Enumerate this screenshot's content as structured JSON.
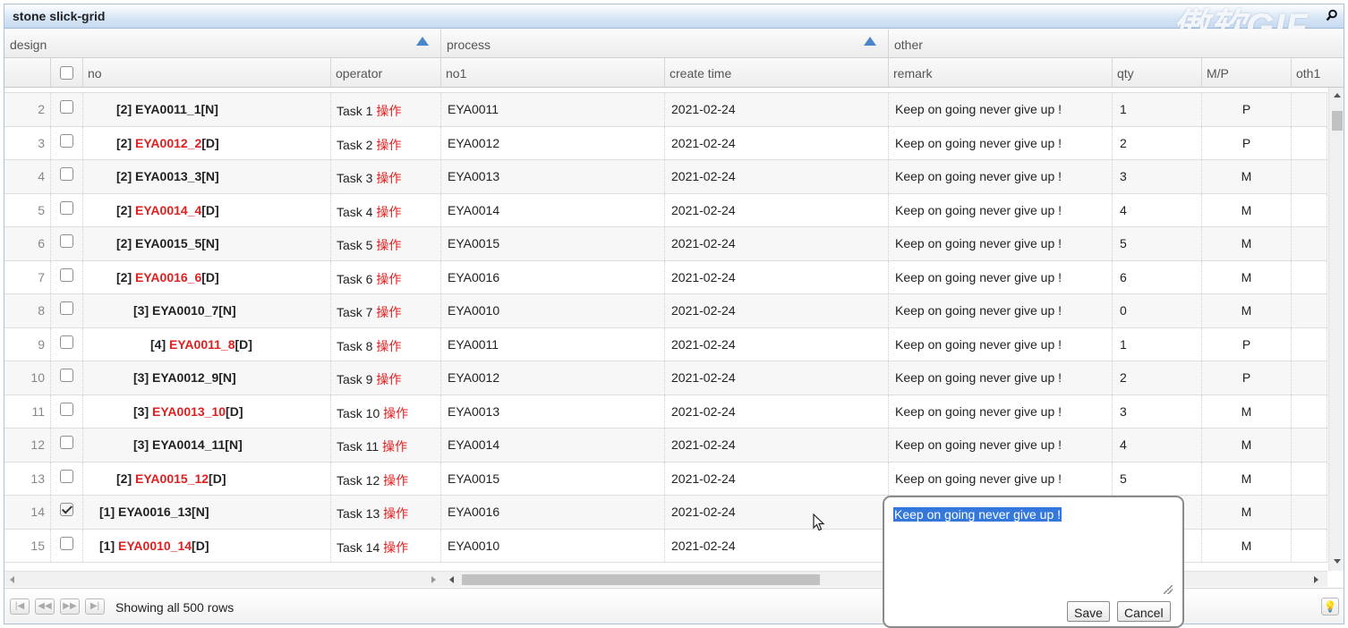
{
  "window": {
    "title": "stone slick-grid",
    "watermark": "傲软GIF"
  },
  "group_headers": [
    "design",
    "process",
    "other"
  ],
  "columns": [
    "no",
    "operator",
    "no1",
    "create time",
    "remark",
    "qty",
    "M/P",
    "oth1"
  ],
  "rows": [
    {
      "num": "2",
      "checked": false,
      "level": 2,
      "code": "EYA0011_1",
      "flag": "N",
      "task": "Task 1",
      "op": "操作",
      "no1": "EYA0011",
      "created": "2021-02-24",
      "remark": "Keep on going never give up !",
      "qty": "1",
      "mp": "P"
    },
    {
      "num": "3",
      "checked": false,
      "level": 2,
      "code": "EYA0012_2",
      "flag": "D",
      "task": "Task 2",
      "op": "操作",
      "no1": "EYA0012",
      "created": "2021-02-24",
      "remark": "Keep on going never give up !",
      "qty": "2",
      "mp": "P"
    },
    {
      "num": "4",
      "checked": false,
      "level": 2,
      "code": "EYA0013_3",
      "flag": "N",
      "task": "Task 3",
      "op": "操作",
      "no1": "EYA0013",
      "created": "2021-02-24",
      "remark": "Keep on going never give up !",
      "qty": "3",
      "mp": "M"
    },
    {
      "num": "5",
      "checked": false,
      "level": 2,
      "code": "EYA0014_4",
      "flag": "D",
      "task": "Task 4",
      "op": "操作",
      "no1": "EYA0014",
      "created": "2021-02-24",
      "remark": "Keep on going never give up !",
      "qty": "4",
      "mp": "M"
    },
    {
      "num": "6",
      "checked": false,
      "level": 2,
      "code": "EYA0015_5",
      "flag": "N",
      "task": "Task 5",
      "op": "操作",
      "no1": "EYA0015",
      "created": "2021-02-24",
      "remark": "Keep on going never give up !",
      "qty": "5",
      "mp": "M"
    },
    {
      "num": "7",
      "checked": false,
      "level": 2,
      "code": "EYA0016_6",
      "flag": "D",
      "task": "Task 6",
      "op": "操作",
      "no1": "EYA0016",
      "created": "2021-02-24",
      "remark": "Keep on going never give up !",
      "qty": "6",
      "mp": "M"
    },
    {
      "num": "8",
      "checked": false,
      "level": 3,
      "code": "EYA0010_7",
      "flag": "N",
      "task": "Task 7",
      "op": "操作",
      "no1": "EYA0010",
      "created": "2021-02-24",
      "remark": "Keep on going never give up !",
      "qty": "0",
      "mp": "M"
    },
    {
      "num": "9",
      "checked": false,
      "level": 4,
      "code": "EYA0011_8",
      "flag": "D",
      "task": "Task 8",
      "op": "操作",
      "no1": "EYA0011",
      "created": "2021-02-24",
      "remark": "Keep on going never give up !",
      "qty": "1",
      "mp": "P"
    },
    {
      "num": "10",
      "checked": false,
      "level": 3,
      "code": "EYA0012_9",
      "flag": "N",
      "task": "Task 9",
      "op": "操作",
      "no1": "EYA0012",
      "created": "2021-02-24",
      "remark": "Keep on going never give up !",
      "qty": "2",
      "mp": "P"
    },
    {
      "num": "11",
      "checked": false,
      "level": 3,
      "code": "EYA0013_10",
      "flag": "D",
      "task": "Task 10",
      "op": "操作",
      "no1": "EYA0013",
      "created": "2021-02-24",
      "remark": "Keep on going never give up !",
      "qty": "3",
      "mp": "M"
    },
    {
      "num": "12",
      "checked": false,
      "level": 3,
      "code": "EYA0014_11",
      "flag": "N",
      "task": "Task 11",
      "op": "操作",
      "no1": "EYA0014",
      "created": "2021-02-24",
      "remark": "Keep on going never give up !",
      "qty": "4",
      "mp": "M"
    },
    {
      "num": "13",
      "checked": false,
      "level": 2,
      "code": "EYA0015_12",
      "flag": "D",
      "task": "Task 12",
      "op": "操作",
      "no1": "EYA0015",
      "created": "2021-02-24",
      "remark": "Keep on going never give up !",
      "qty": "5",
      "mp": "M"
    },
    {
      "num": "14",
      "checked": true,
      "level": 1,
      "code": "EYA0016_13",
      "flag": "N",
      "task": "Task 13",
      "op": "操作",
      "no1": "EYA0016",
      "created": "2021-02-24",
      "remark": "",
      "qty": "",
      "mp": "M"
    },
    {
      "num": "15",
      "checked": false,
      "level": 1,
      "code": "EYA0010_14",
      "flag": "D",
      "task": "Task 14",
      "op": "操作",
      "no1": "EYA0010",
      "created": "2021-02-24",
      "remark": "",
      "qty": "",
      "mp": "M"
    }
  ],
  "footer": {
    "status": "Showing all 500 rows"
  },
  "editor": {
    "value": "Keep on going never give up !",
    "save_label": "Save",
    "cancel_label": "Cancel"
  },
  "colors": {
    "accent": "#4a86c8",
    "deleted_text": "#e02020",
    "selection": "#3478dc"
  }
}
